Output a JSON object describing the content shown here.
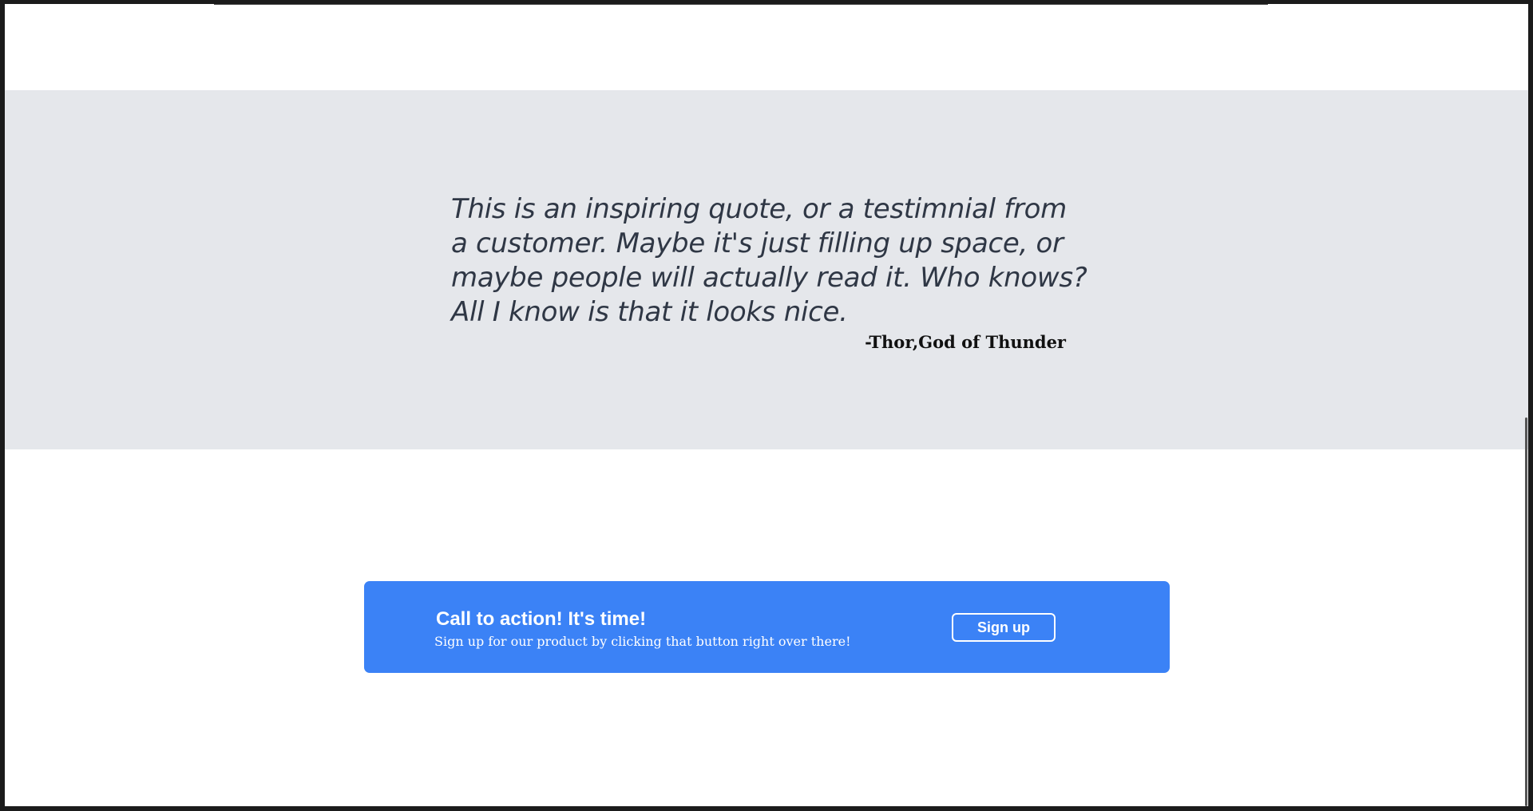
{
  "quote": {
    "text": "This is an inspiring quote, or a testimnial from a customer. Maybe it's just filling up space, or maybe people will actually read it. Who knows? All I know is that it looks nice.",
    "author": "-Thor,God of Thunder"
  },
  "cta": {
    "title": "Call to action! It's time!",
    "subtitle": "Sign up for our product by clicking that button right over there!",
    "button_label": "Sign up"
  },
  "colors": {
    "quote_bg": "#e5e7eb",
    "cta_bg": "#3b82f6",
    "text_dark": "#2f3745"
  }
}
